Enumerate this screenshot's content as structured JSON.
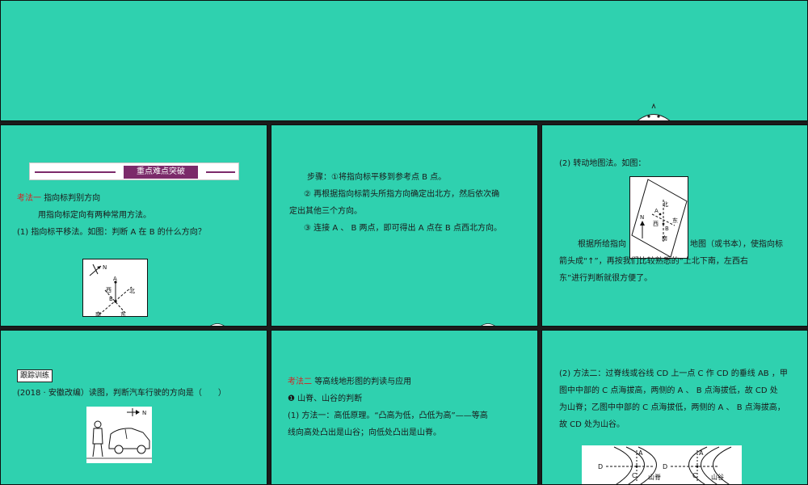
{
  "slide2": {
    "banner": "重点难点突破",
    "method_title": "考法一",
    "method_rest": "指向标判别方向",
    "line1": "用指向标定向有两种常用方法。",
    "line2": "(1) 指向标平移法。如图：判断 A 在 B 的什么方向？",
    "figure": {
      "north": "N",
      "a": "A",
      "b": "B",
      "west": "西",
      "east": "东",
      "south": "南",
      "north_cn": "北"
    }
  },
  "slide3": {
    "step1": "步骤：①将指向标平移到参考点 B 点。",
    "step2a": "② 再根据指向标箭头所指方向确定出北方，然后依次确",
    "step2b": "定出其他三个方向。",
    "step3": "③ 连接 A 、 B 两点，即可得出 A 点在 B 点西北方向。"
  },
  "slide4": {
    "heading": "(2) 转动地图法。如图：",
    "para_a": "根据所给指向",
    "para_b": "地图（或书本），使指向标",
    "para2": "箭头成“↑”，再按我们比较熟悉的“上北下南，左西右",
    "para3": "东”进行判断就很方便了。",
    "figure": {
      "north": "N",
      "north_cn": "北",
      "a": "A",
      "b": "B",
      "west": "西",
      "east": "东",
      "south": "南"
    }
  },
  "slide5": {
    "badge": "跟踪训练",
    "question": "(2018 · 安徽改编）读图，判断汽车行驶的方向是（　　）",
    "figure": {
      "north": "N"
    }
  },
  "slide6": {
    "method_title": "考法二",
    "method_rest": "等高线地形图的判读与应用",
    "sub": "❶ 山脊、山谷的判断",
    "line1": "(1) 方法一：高低原理。“凸高为低，凸低为高”——等高",
    "line2": "线向高处凸出是山谷；向低处凸出是山脊。"
  },
  "slide7": {
    "line1": "(2) 方法二：过脊线或谷线 CD 上一点 C 作 CD 的垂线 AB ，甲",
    "line2": "图中中部的 C 点海拔高，两侧的 A 、 B 点海拔低，故 CD 处",
    "line3": "为山脊；乙图中中部的 C 点海拔低，两侧的 A 、 B 点海拔高，",
    "line4": "故 CD 处为山谷。",
    "figure": {
      "d1": "D",
      "a1": "A",
      "c1": "C",
      "ridge": "山脊",
      "d2": "D",
      "a2": "A",
      "c2": "C",
      "valley": "山谷"
    }
  }
}
